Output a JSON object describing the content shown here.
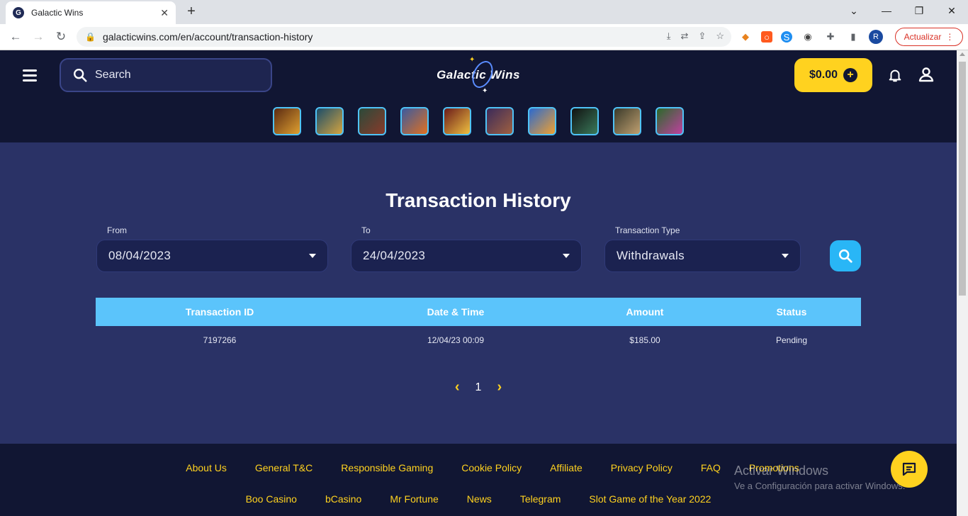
{
  "browser": {
    "tab_title": "Galactic Wins",
    "tab_favicon_letter": "G",
    "url": "galacticwins.com/en/account/transaction-history",
    "profile_initial": "R",
    "update_label": "Actualizar"
  },
  "header": {
    "search_placeholder": "Search",
    "logo_text": "Galactic Wins",
    "balance": "$0.00",
    "games": [
      "game-1",
      "game-2",
      "game-3",
      "game-4",
      "game-5",
      "game-6",
      "game-7",
      "game-8",
      "game-9",
      "game-10"
    ]
  },
  "main": {
    "title": "Transaction History",
    "filters": {
      "from_label": "From",
      "from_value": "08/04/2023",
      "to_label": "To",
      "to_value": "24/04/2023",
      "type_label": "Transaction Type",
      "type_value": "Withdrawals"
    },
    "table": {
      "headers": [
        "Transaction ID",
        "Date & Time",
        "Amount",
        "Status"
      ],
      "rows": [
        [
          "7197266",
          "12/04/23 00:09",
          "$185.00",
          "Pending"
        ]
      ]
    },
    "pagination": {
      "prev": "‹",
      "current": "1",
      "next": "›"
    }
  },
  "footer": {
    "row1": [
      "About Us",
      "General T&C",
      "Responsible Gaming",
      "Cookie Policy",
      "Affiliate",
      "Privacy Policy",
      "FAQ",
      "Promotions"
    ],
    "row2": [
      "Boo Casino",
      "bCasino",
      "Mr Fortune",
      "News",
      "Telegram",
      "Slot Game of the Year 2022"
    ]
  },
  "watermark": {
    "line1": "Activar Windows",
    "line2": "Ve a Configuración para activar Windows."
  },
  "colors": {
    "accent": "#ffd21f",
    "header_bg": "#111633",
    "main_bg": "#2a3266",
    "table_header": "#5bc4fb",
    "search_button": "#29b6f6"
  }
}
